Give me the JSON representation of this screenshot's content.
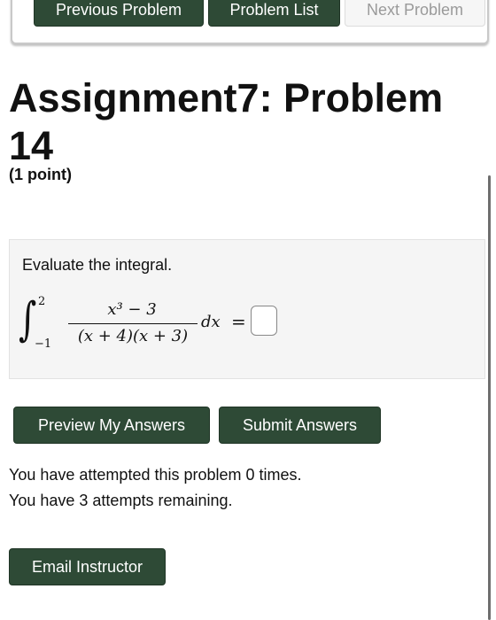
{
  "nav": {
    "previous_label": "Previous Problem",
    "list_label": "Problem List",
    "next_label": "Next Problem"
  },
  "header": {
    "title": "Assignment7: Problem 14",
    "points": "(1 point)"
  },
  "problem": {
    "prompt": "Evaluate the integral.",
    "integral": {
      "upper_limit": "2",
      "lower_limit": "−1",
      "numerator": "x³ − 3",
      "denominator": "(x + 4)(x + 3)",
      "differential": "dx",
      "equals": "="
    },
    "answer_value": ""
  },
  "actions": {
    "preview_label": "Preview My Answers",
    "submit_label": "Submit Answers"
  },
  "status": {
    "attempts_made": "You have attempted this problem 0 times.",
    "attempts_remaining": "You have 3 attempts remaining."
  },
  "footer": {
    "email_label": "Email Instructor"
  },
  "colors": {
    "button_dark_green": "#2e4a36",
    "disabled_text": "#9a9a9a",
    "problem_background": "#f5f5f5"
  }
}
